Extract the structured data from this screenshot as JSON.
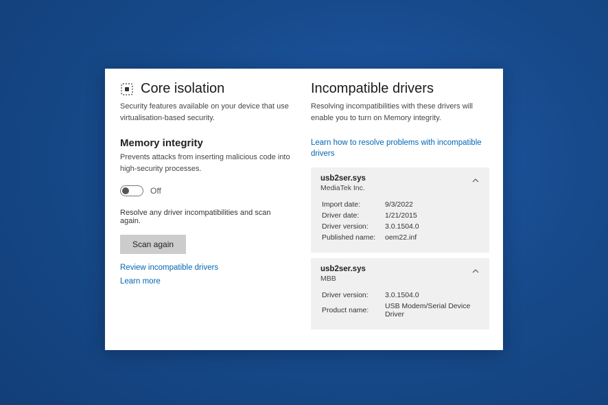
{
  "left": {
    "title": "Core isolation",
    "desc": "Security features available on your device that use virtualisation-based security.",
    "section_title": "Memory integrity",
    "section_desc": "Prevents attacks from inserting malicious code into high-security processes.",
    "toggle_state": "Off",
    "resolve_hint": "Resolve any driver incompatibilities and scan again.",
    "scan_button": "Scan again",
    "link_review": "Review incompatible drivers",
    "link_learn": "Learn more"
  },
  "right": {
    "title": "Incompatible drivers",
    "desc": "Resolving incompatibilities with these drivers will enable you to turn on Memory integrity.",
    "link_resolve": "Learn how to resolve problems with incompatible drivers",
    "drivers": [
      {
        "name": "usb2ser.sys",
        "vendor": "MediaTek Inc.",
        "rows": [
          {
            "label": "Import date:",
            "value": "9/3/2022"
          },
          {
            "label": "Driver date:",
            "value": "1/21/2015"
          },
          {
            "label": "Driver version:",
            "value": "3.0.1504.0"
          },
          {
            "label": "Published name:",
            "value": "oem22.inf"
          }
        ]
      },
      {
        "name": "usb2ser.sys",
        "vendor": "MBB",
        "rows": [
          {
            "label": "Driver version:",
            "value": "3.0.1504.0"
          },
          {
            "label": "Product name:",
            "value": "USB Modem/Serial Device Driver"
          }
        ]
      }
    ]
  }
}
